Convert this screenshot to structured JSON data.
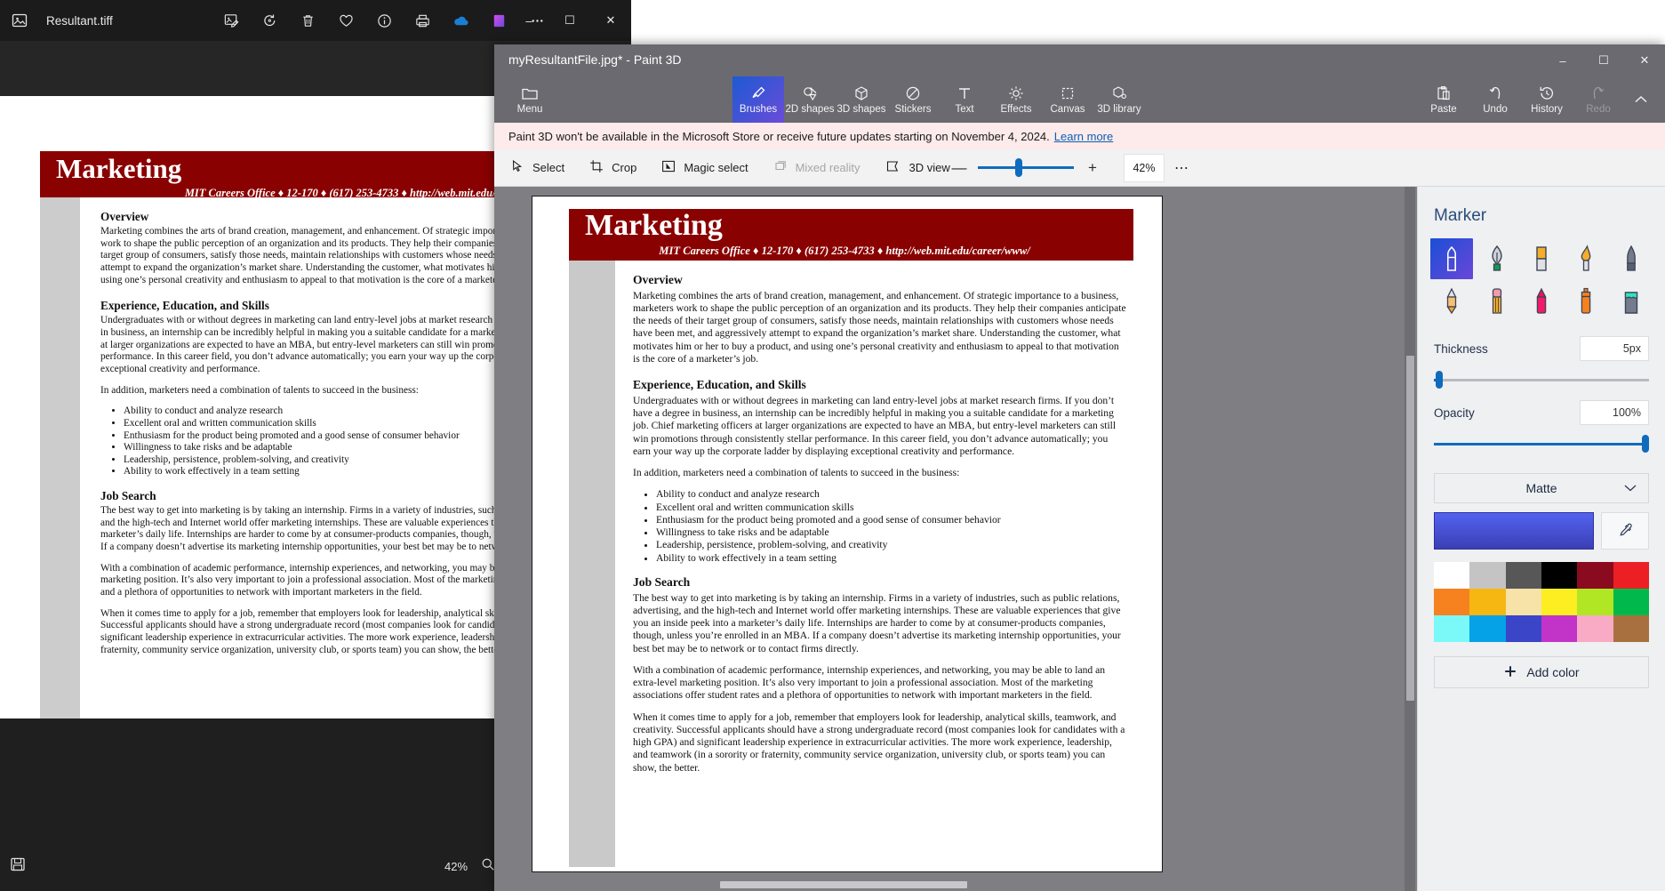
{
  "photos_window": {
    "title": "Resultant.tiff",
    "app_icon": "photo-icon",
    "toolbar": [
      {
        "name": "edit-image-icon",
        "glyph": "edit"
      },
      {
        "name": "rotate-icon",
        "glyph": "rotate"
      },
      {
        "name": "delete-icon",
        "glyph": "trash"
      },
      {
        "name": "favorite-icon",
        "glyph": "heart"
      },
      {
        "name": "info-icon",
        "glyph": "info"
      },
      {
        "name": "print-icon",
        "glyph": "print"
      },
      {
        "name": "onedrive-icon",
        "glyph": "cloud"
      },
      {
        "name": "designer-icon",
        "glyph": "designer"
      },
      {
        "name": "see-more-icon",
        "glyph": "dots"
      }
    ],
    "window_controls": {
      "minimize": "–",
      "maximize": "☐",
      "close": "✕"
    },
    "status": {
      "zoom": "42%",
      "zoom_icon": "magnifier-icon",
      "save_icon": "save-icon"
    }
  },
  "paint3d": {
    "title": "myResultantFile.jpg* - Paint 3D",
    "window_controls": {
      "minimize": "–",
      "maximize": "☐",
      "close": "✕"
    },
    "ribbon": {
      "menu": {
        "label": "Menu",
        "icon": "folder-icon"
      },
      "tools": [
        {
          "label": "Brushes",
          "icon": "brush-icon",
          "state": "active"
        },
        {
          "label": "2D shapes",
          "icon": "2d-shapes-icon",
          "state": "normal"
        },
        {
          "label": "3D shapes",
          "icon": "3d-shapes-icon",
          "state": "normal"
        },
        {
          "label": "Stickers",
          "icon": "stickers-icon",
          "state": "normal"
        },
        {
          "label": "Text",
          "icon": "text-icon",
          "state": "normal"
        },
        {
          "label": "Effects",
          "icon": "effects-icon",
          "state": "normal"
        },
        {
          "label": "Canvas",
          "icon": "canvas-icon",
          "state": "normal"
        },
        {
          "label": "3D library",
          "icon": "3d-library-icon",
          "state": "normal"
        }
      ],
      "actions": [
        {
          "label": "Paste",
          "icon": "paste-icon",
          "state": "normal"
        },
        {
          "label": "Undo",
          "icon": "undo-icon",
          "state": "normal"
        },
        {
          "label": "History",
          "icon": "history-icon",
          "state": "normal"
        },
        {
          "label": "Redo",
          "icon": "redo-icon",
          "state": "disabled"
        }
      ],
      "collapse_icon": "chevron-up-icon"
    },
    "banner": {
      "text": "Paint 3D won't be available in the Microsoft Store or receive future updates starting on November 4, 2024.",
      "link": "Learn more"
    },
    "toolstrip": {
      "items": [
        {
          "label": "Select",
          "icon": "cursor-icon",
          "state": "normal"
        },
        {
          "label": "Crop",
          "icon": "crop-icon",
          "state": "normal"
        },
        {
          "label": "Magic select",
          "icon": "magic-select-icon",
          "state": "normal"
        },
        {
          "label": "Mixed reality",
          "icon": "mixed-reality-icon",
          "state": "disabled"
        },
        {
          "label": "3D view",
          "icon": "3d-view-icon",
          "state": "normal"
        }
      ],
      "zoom_out": "—",
      "zoom_in": "+",
      "zoom_value": "42%",
      "more": "⋯"
    },
    "panel": {
      "title": "Marker",
      "tools": [
        {
          "name": "marker-tool",
          "selected": true
        },
        {
          "name": "calligraphy-pen-tool",
          "selected": false
        },
        {
          "name": "oil-brush-tool",
          "selected": false
        },
        {
          "name": "watercolor-tool",
          "selected": false
        },
        {
          "name": "pixel-pen-tool",
          "selected": false
        },
        {
          "name": "pencil-tool",
          "selected": false
        },
        {
          "name": "eraser-tool",
          "selected": false
        },
        {
          "name": "crayon-tool",
          "selected": false
        },
        {
          "name": "spray-can-tool",
          "selected": false
        },
        {
          "name": "fill-tool",
          "selected": false
        }
      ],
      "thickness": {
        "label": "Thickness",
        "value": "5px",
        "slider_percent": 4
      },
      "opacity": {
        "label": "Opacity",
        "value": "100%",
        "slider_percent": 100
      },
      "material": {
        "label": "Matte",
        "chevron": "⌄"
      },
      "current_color": "#4a56e0",
      "eyedropper_icon": "eyedropper-icon",
      "swatches": [
        "#ffffff",
        "#c4c4c4",
        "#575757",
        "#000000",
        "#8a0a1f",
        "#ec2024",
        "#f6811f",
        "#f6b713",
        "#f7e3a8",
        "#fcee21",
        "#b1e625",
        "#00b84c",
        "#7bf9f9",
        "#05a2e8",
        "#3a45c8",
        "#c234c8",
        "#f9aac4",
        "#a9703f"
      ],
      "add_color": {
        "label": "Add color",
        "icon": "plus-icon"
      }
    }
  },
  "document": {
    "banner_title": "Marketing",
    "banner_subtitle": "MIT Careers Office ♦ 12-170 ♦ (617) 253-4733 ♦ http://web.mit.edu/career/www/",
    "sections": [
      {
        "heading": "Overview",
        "paragraphs": [
          "Marketing combines the arts of brand creation, management, and enhancement.  Of strategic importance to a business, marketers work to shape the public perception of an organization and its products.  They help their companies anticipate the needs of their target group of consumers, satisfy those needs, maintain relationships with customers whose needs have been met, and aggressively attempt to expand the organization’s market share.  Understanding the customer, what motivates him or her to buy a product, and using one’s personal creativity and enthusiasm to appeal to that motivation is the core of a marketer’s job."
        ]
      },
      {
        "heading": "Experience, Education, and Skills",
        "paragraphs": [
          "Undergraduates with or without degrees in marketing can land entry-level jobs at market research firms.  If you don’t have a degree in business, an internship can be incredibly helpful in making you a suitable candidate for a marketing job.  Chief marketing officers at larger organizations are expected to have an MBA, but entry-level marketers can still win promotions through consistently stellar performance.  In this career field, you don’t advance automatically; you earn your way up the corporate ladder by displaying exceptional creativity and performance.",
          "In addition, marketers need a combination of talents to succeed in the business:"
        ],
        "bullets": [
          "Ability to conduct and analyze research",
          "Excellent oral and written communication skills",
          "Enthusiasm for the product being promoted and a good sense of consumer behavior",
          "Willingness to take risks and be adaptable",
          "Leadership, persistence, problem-solving, and creativity",
          "Ability to work effectively in a team setting"
        ]
      },
      {
        "heading": "Job Search",
        "paragraphs": [
          "The best way to get into marketing is by taking an internship.  Firms in a variety of industries, such as public relations, advertising, and the high-tech and Internet world offer marketing internships.  These are valuable experiences that give you an inside peek into a marketer’s daily life.  Internships are harder to come by at consumer-products companies, though, unless you’re enrolled in an MBA.  If a company doesn’t advertise its marketing internship opportunities, your best bet may be to network or to contact firms directly.",
          "With a combination of academic performance, internship experiences, and networking, you may be able to land an extra-level marketing position.  It’s also very important to join a professional association.  Most of the marketing associations offer student rates and a plethora of opportunities to network with important marketers in the field.",
          "When it comes time to apply for a job, remember that employers look for leadership, analytical skills, teamwork, and creativity.  Successful applicants should have a strong undergraduate record (most companies look for candidates with a high GPA) and significant leadership experience in extracurricular activities.  The more work experience, leadership, and teamwork (in a sorority or fraternity, community service organization, university club, or sports team) you can show, the better."
        ]
      }
    ]
  }
}
